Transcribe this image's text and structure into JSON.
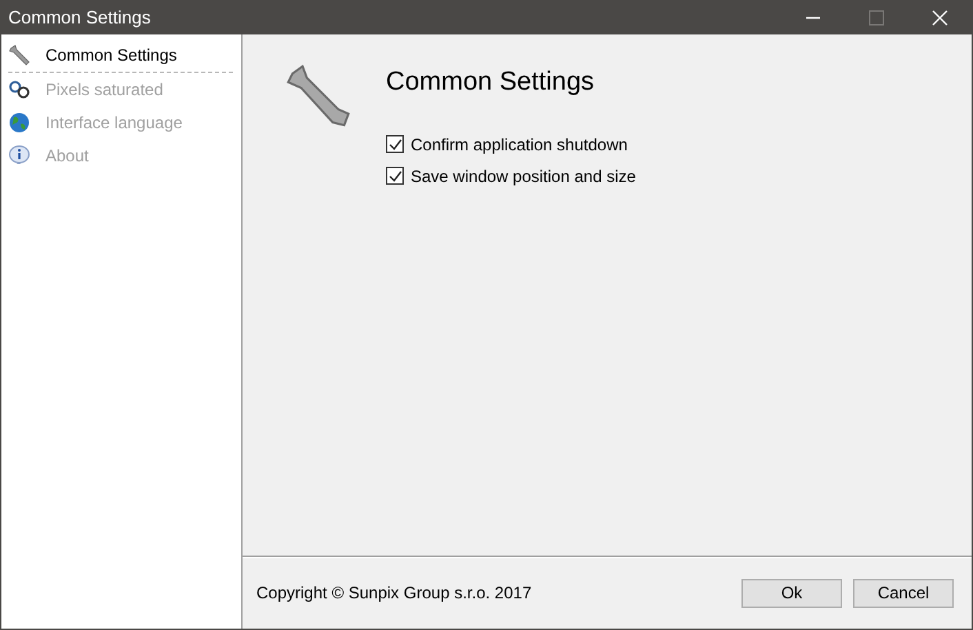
{
  "window": {
    "title": "Common Settings",
    "controls": [
      {
        "kind": "minimize",
        "disabled": false
      },
      {
        "kind": "maximize",
        "disabled": true
      },
      {
        "kind": "close",
        "disabled": false
      }
    ]
  },
  "sidebar": {
    "items": [
      {
        "label": "Common Settings",
        "kind": "wrench",
        "selected": true
      },
      {
        "label": "Pixels saturated",
        "kind": "pixels",
        "selected": false
      },
      {
        "label": "Interface language",
        "kind": "globe",
        "selected": false
      },
      {
        "label": "About",
        "kind": "info",
        "selected": false
      }
    ]
  },
  "page": {
    "title": "Common Settings",
    "options": [
      {
        "label": "Confirm application shutdown",
        "checked": true
      },
      {
        "label": "Save window position and size",
        "checked": true
      }
    ]
  },
  "footer": {
    "copyright": "Copyright © Sunpix Group s.r.o. 2017",
    "buttons": [
      "Ok",
      "Cancel"
    ]
  }
}
